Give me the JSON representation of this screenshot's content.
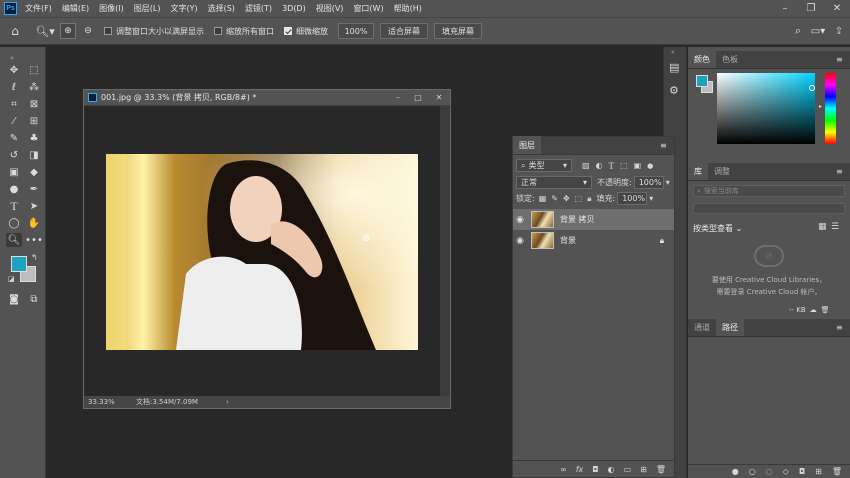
{
  "menu": {
    "items": [
      "文件(F)",
      "编辑(E)",
      "图像(I)",
      "图层(L)",
      "文字(Y)",
      "选择(S)",
      "滤镜(T)",
      "3D(D)",
      "视图(V)",
      "窗口(W)",
      "帮助(H)"
    ],
    "logo": "Ps"
  },
  "options": {
    "resize_windows": "调整窗口大小以满屏显示",
    "zoom_all": "缩放所有窗口",
    "scrubby_zoom": "细微缩放",
    "zoom_value": "100%",
    "fit_screen": "适合屏幕",
    "fill_screen": "填充屏幕"
  },
  "document": {
    "title": "001.jpg @ 33.3% (背景 拷贝, RGB/8#) *",
    "zoom": "33.33%",
    "docinfo": "文档:3.54M/7.09M",
    "arrow": "›"
  },
  "layers_panel": {
    "tab": "图层",
    "filter_label": "类型",
    "blend_mode": "正常",
    "opacity_label": "不透明度:",
    "opacity_value": "100%",
    "lock_label": "锁定:",
    "fill_label": "填充:",
    "fill_value": "100%",
    "layers": [
      {
        "name": "背景 拷贝",
        "selected": true
      },
      {
        "name": "背景",
        "selected": false
      }
    ]
  },
  "color_panel": {
    "tabs": [
      "颜色",
      "色板"
    ],
    "foreground": "#1ba3bd"
  },
  "library_panel": {
    "tabs": [
      "库",
      "调整"
    ],
    "search_placeholder": "搜索当前库",
    "view_by": "按类型查看",
    "message_line1": "要使用 Creative Cloud Libraries，",
    "message_line2": "需要登录 Creative Cloud 帐户。",
    "size": "-- KB"
  },
  "channels_panel": {
    "tabs": [
      "通道",
      "路径"
    ]
  },
  "colors": {
    "accent": "#1ba3bd"
  }
}
